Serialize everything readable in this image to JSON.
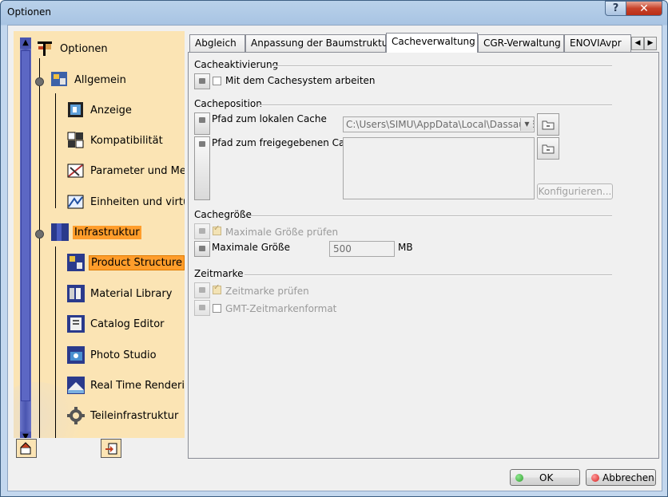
{
  "window": {
    "title": "Optionen",
    "help_glyph": "?",
    "close_glyph": "✕"
  },
  "tree": {
    "items": [
      {
        "label": "Optionen",
        "icon": "options-tree-icon"
      },
      {
        "label": "Allgemein",
        "icon": "general-icon"
      },
      {
        "label": "Anzeige",
        "icon": "display-icon"
      },
      {
        "label": "Kompatibilität",
        "icon": "compatibility-icon"
      },
      {
        "label": "Parameter und Mess",
        "icon": "parameters-icon"
      },
      {
        "label": "Einheiten und virtue",
        "icon": "units-icon"
      },
      {
        "label": "Infrastruktur",
        "icon": "infrastructure-icon"
      },
      {
        "label": "Product Structure",
        "icon": "product-structure-icon"
      },
      {
        "label": "Material Library",
        "icon": "material-library-icon"
      },
      {
        "label": "Catalog Editor",
        "icon": "catalog-editor-icon"
      },
      {
        "label": "Photo Studio",
        "icon": "photo-studio-icon"
      },
      {
        "label": "Real Time Rendering",
        "icon": "real-time-rendering-icon"
      },
      {
        "label": "Teileinfrastruktur",
        "icon": "gear-icon"
      }
    ],
    "scroll_up": "▲",
    "scroll_down": "▼"
  },
  "tabs": [
    {
      "label": "Abgleich"
    },
    {
      "label": "Anpassung der Baumstruktur"
    },
    {
      "label": "Cacheverwaltung"
    },
    {
      "label": "CGR-Verwaltung"
    },
    {
      "label": "ENOVIAvpr"
    }
  ],
  "tab_scroll": {
    "left": "◀",
    "right": "▶"
  },
  "cacheaktivierung": {
    "title": "Cacheaktivierung",
    "checkbox_label": "Mit dem Cachesystem arbeiten"
  },
  "cacheposition": {
    "title": "Cacheposition",
    "local_label": "Pfad zum lokalen Cache",
    "local_value": "C:\\Users\\SIMU\\AppData\\Local\\DassaultSy",
    "shared_label": "Pfad zum freigegebenen Cache",
    "configure_label": "Konfigurieren..."
  },
  "cachegroesse": {
    "title": "Cachegröße",
    "check_label": "Maximale Größe prüfen",
    "max_label": "Maximale Größe",
    "max_value": "500",
    "unit": "MB"
  },
  "zeitmarke": {
    "title": "Zeitmarke",
    "check_label": "Zeitmarke prüfen",
    "gmt_label": "GMT-Zeitmarkenformat"
  },
  "dialog": {
    "ok_label": "OK",
    "cancel_label": "Abbrechen"
  },
  "colors": {
    "selection": "#ff9d2b",
    "tree_bg": "#fbe4b4",
    "ok_dot": "#2e9e2e",
    "cancel_dot": "#d42020"
  }
}
